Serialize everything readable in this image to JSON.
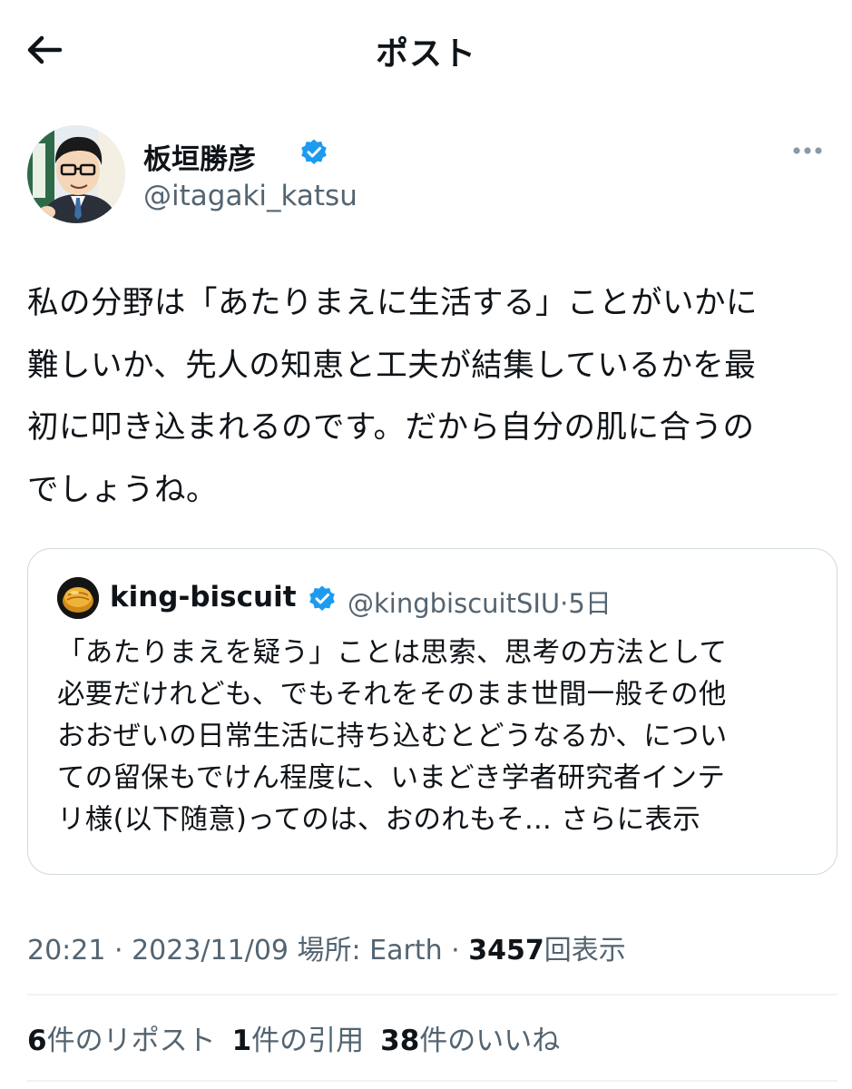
{
  "header": {
    "title": "ポスト",
    "back_icon": "arrow-left-icon"
  },
  "author": {
    "name": "板垣勝彦",
    "handle": "@itagaki_katsu",
    "verified_color": "#1d9bf0"
  },
  "tweet": {
    "text": "私の分野は「あたりまえに生活する」ことがいかに\n難しいか、先人の知恵と工夫が結集しているかを最\n初に叩き込まれるのです。だから自分の肌に合うの\nでしょうね。"
  },
  "quote": {
    "name": "king-biscuit",
    "handle": "@kingbiscuitSIU",
    "separator": "·",
    "time": "5日",
    "text": "「あたりまえを疑う」ことは思索、思考の方法として\n必要だけれども、でもそれをそのまま世間一般その他\nおおぜいの日常生活に持ち込むとどうなるか、につい\nての留保もでけん程度に、いまどき学者研究者インテ\nリ様(以下随意)ってのは、おのれもそ...",
    "show_more": " さらに表示"
  },
  "meta": {
    "time": "20:21",
    "sep1": " · ",
    "date": "2023/11/09",
    "location": " 場所: Earth",
    "sep2": " · ",
    "views_count": "3457",
    "views_label": "回表示"
  },
  "stats": {
    "reposts_count": "6",
    "reposts_label": "件のリポスト",
    "quotes_count": "1",
    "quotes_label": "件の引用",
    "likes_count": "38",
    "likes_label": "件のいいね"
  },
  "colors": {
    "text": "#0f1419",
    "secondary": "#536471",
    "border": "#cfd9de",
    "accent": "#1d9bf0"
  }
}
